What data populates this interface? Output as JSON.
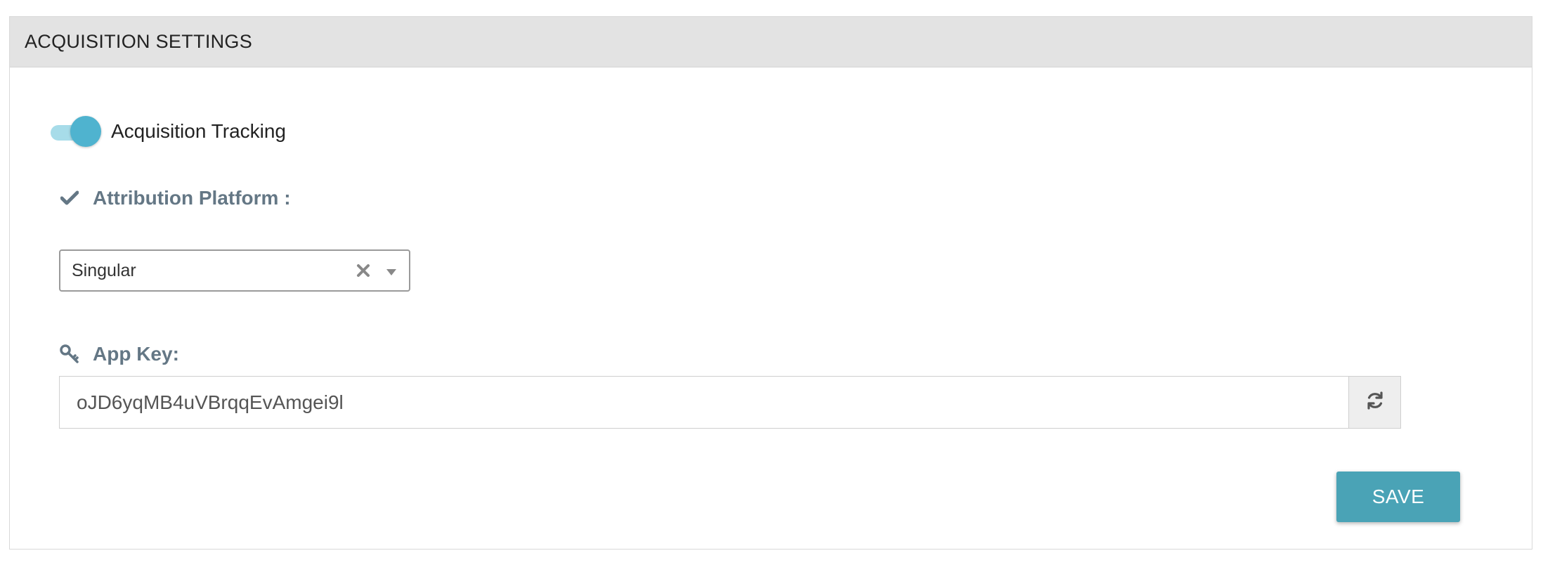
{
  "panel": {
    "title": "ACQUISITION SETTINGS"
  },
  "tracking": {
    "label": "Acquisition Tracking",
    "enabled": true
  },
  "attribution": {
    "label": "Attribution Platform :",
    "icon": "check-icon",
    "selected": "Singular"
  },
  "app_key": {
    "label": "App Key:",
    "icon": "key-icon",
    "value": "oJD6yqMB4uVBrqqEvAmgei9l",
    "refresh_icon": "refresh-icon"
  },
  "actions": {
    "save_label": "SAVE"
  },
  "colors": {
    "accent": "#4fb3cf",
    "save_button": "#4aa3b6",
    "label": "#647785"
  }
}
